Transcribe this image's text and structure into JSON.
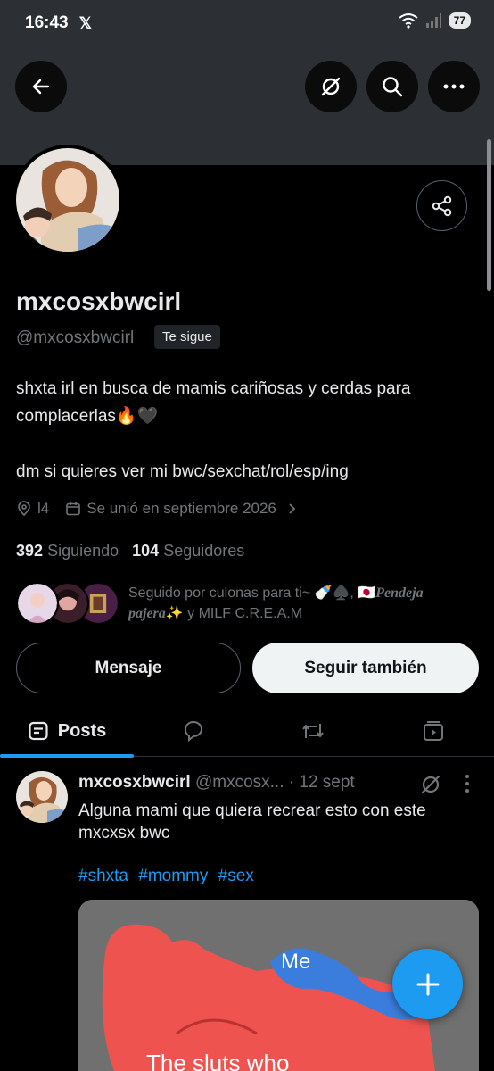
{
  "status_bar": {
    "time": "16:43",
    "app_icon": "x-logo-icon",
    "battery": "77"
  },
  "header": {
    "back_icon": "back-arrow-icon",
    "grok_icon": "grok-icon",
    "search_icon": "search-icon",
    "more_icon": "more-icon"
  },
  "profile": {
    "name": "mxcosxbwcirl",
    "handle": "@mxcosxbwcirl",
    "follows_you": "Te sigue",
    "bio_line1": "shxta irl en busca de mamis cariñosas y cerdas para complacerlas🔥🖤",
    "bio_line2": "dm si quieres ver mi bwc/sexchat/rol/esp/ing",
    "location": "l4",
    "joined": "Se unió en septiembre 2026",
    "following_count": "392",
    "following_label": "Siguiendo",
    "followers_count": "104",
    "followers_label": "Seguidores",
    "followed_by_prefix": "Seguido por culonas para ti~ 🍼♠️, 🇯🇵",
    "followed_by_italic": "Pendeja pajera",
    "followed_by_suffix": "✨ y MILF C.R.E.A.M"
  },
  "actions": {
    "message_label": "Mensaje",
    "follow_label": "Seguir también"
  },
  "tabs": [
    {
      "label": "Posts",
      "icon": "posts-icon"
    },
    {
      "label": "",
      "icon": "reply-icon"
    },
    {
      "label": "",
      "icon": "retweet-icon"
    },
    {
      "label": "",
      "icon": "media-icon"
    }
  ],
  "post": {
    "name": "mxcosxbwcirl",
    "handle": "@mxcosx...",
    "time": "· 12 sept",
    "text": "Alguna mami que quiera recrear esto con este mxcxsx bwc",
    "hashtags": [
      "#shxta",
      "#mommy",
      "#sex"
    ],
    "media_me_label": "Me",
    "media_caption": "The sluts who"
  },
  "colors": {
    "accent": "#1d9bf0",
    "background": "#000000",
    "banner": "#2c2f33",
    "muted": "#71767b"
  }
}
